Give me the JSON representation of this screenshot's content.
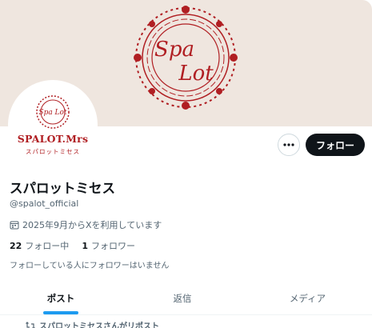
{
  "profile": {
    "banner_logo_text_1": "Spa",
    "banner_logo_text_2": "Lot",
    "avatar_logo_text": "Spa Lot",
    "avatar_name": "SPALOT.Mrs",
    "avatar_sub": "スパロットミセス",
    "display_name": "スパロットミセス",
    "handle": "@spalot_official",
    "joined": "2025年9月からXを利用しています",
    "following_count": "22",
    "following_label": "フォロー中",
    "followers_count": "1",
    "followers_label": "フォロワー",
    "no_followers_note": "フォローしている人にフォロワーはいません"
  },
  "actions": {
    "more_icon": "more-horizontal-icon",
    "follow_label": "フォロー"
  },
  "tabs": [
    {
      "label": "ポスト",
      "active": true
    },
    {
      "label": "返信",
      "active": false
    },
    {
      "label": "メディア",
      "active": false
    }
  ],
  "timeline": {
    "repost_note": "スパロットミセスさんがリポスト"
  },
  "colors": {
    "brand_red": "#b01e22",
    "accent_blue": "#1d9bf0",
    "banner_bg": "#efe6df"
  }
}
